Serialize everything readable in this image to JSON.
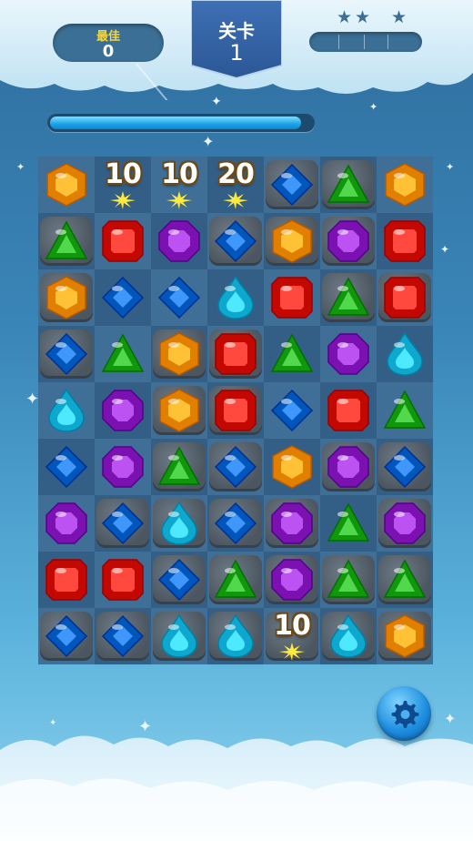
{
  "hud": {
    "best_label": "最佳",
    "best_value": "0",
    "level_label": "关卡",
    "level_value": "1",
    "stars_total": 3,
    "stars_earned": 0
  },
  "moves_progress": 0.96,
  "board": {
    "rows": 9,
    "cols": 7,
    "grid": [
      [
        "orange-hexagon",
        "score-10",
        "score-10",
        "score-20",
        "blue-diamond",
        "green-triangle",
        "orange-hexagon"
      ],
      [
        "green-triangle",
        "red-square",
        "purple-octagon",
        "blue-diamond",
        "orange-hexagon",
        "purple-octagon",
        "red-square"
      ],
      [
        "orange-hexagon",
        "blue-diamond",
        "blue-diamond",
        "cyan-drop",
        "red-square",
        "green-triangle",
        "red-square"
      ],
      [
        "blue-diamond",
        "green-triangle",
        "orange-hexagon",
        "red-square",
        "green-triangle",
        "purple-octagon",
        "cyan-drop"
      ],
      [
        "cyan-drop",
        "purple-octagon",
        "orange-hexagon",
        "red-square",
        "blue-diamond",
        "red-square",
        "green-triangle"
      ],
      [
        "blue-diamond",
        "purple-octagon",
        "green-triangle",
        "blue-diamond",
        "orange-hexagon",
        "purple-octagon",
        "blue-diamond"
      ],
      [
        "purple-octagon",
        "blue-diamond",
        "cyan-drop",
        "blue-diamond",
        "purple-octagon",
        "green-triangle",
        "purple-octagon"
      ],
      [
        "red-square",
        "red-square",
        "blue-diamond",
        "green-triangle",
        "purple-octagon",
        "green-triangle",
        "green-triangle"
      ],
      [
        "blue-diamond",
        "blue-diamond",
        "cyan-drop",
        "cyan-drop",
        "score-10",
        "cyan-drop",
        "orange-hexagon"
      ]
    ],
    "rocks": [
      [
        0,
        0,
        0,
        0,
        1,
        1,
        0
      ],
      [
        1,
        0,
        0,
        1,
        1,
        1,
        0
      ],
      [
        1,
        0,
        0,
        0,
        0,
        1,
        1
      ],
      [
        1,
        0,
        1,
        1,
        0,
        0,
        0
      ],
      [
        0,
        0,
        1,
        1,
        0,
        0,
        0
      ],
      [
        0,
        0,
        1,
        1,
        0,
        1,
        1
      ],
      [
        0,
        1,
        1,
        1,
        1,
        0,
        1
      ],
      [
        0,
        0,
        1,
        1,
        1,
        1,
        1
      ],
      [
        1,
        1,
        1,
        1,
        1,
        1,
        1
      ]
    ]
  },
  "score_popups": {
    "score-10": "10",
    "score-20": "20"
  },
  "colors": {
    "red": "#e0261c",
    "orange": "#ff9e12",
    "blue": "#1c74d8",
    "green": "#2fb52a",
    "purple": "#9a2fd0",
    "cyan": "#2cc6ec"
  },
  "settings_icon": "gear-icon"
}
